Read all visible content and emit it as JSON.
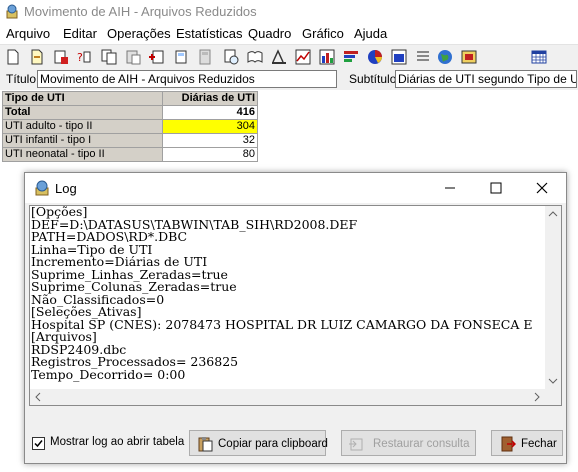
{
  "window": {
    "title": "Movimento de AIH - Arquivos Reduzidos"
  },
  "menu": [
    "Arquivo",
    "Editar",
    "Operações",
    "Estatísticas",
    "Quadro",
    "Gráfico",
    "Ajuda"
  ],
  "title_row": {
    "titulo_label": "Título",
    "titulo_value": "Movimento de AIH - Arquivos Reduzidos",
    "subtitulo_label": "Subtítulo",
    "subtitulo_value": "Diárias de UTI segundo Tipo de UTI"
  },
  "grid": {
    "headers": [
      "Tipo de UTI",
      "Diárias de UTI"
    ],
    "total": {
      "label": "Total",
      "value": "416"
    },
    "rows": [
      {
        "label": "UTI adulto - tipo II",
        "value": "304"
      },
      {
        "label": "UTI infantil - tipo I",
        "value": "32"
      },
      {
        "label": "UTI neonatal - tipo II",
        "value": "80"
      }
    ],
    "highlight_color": "#ffff00"
  },
  "log_window": {
    "title": "Log",
    "content": "[Opções]\nDEF=D:\\DATASUS\\TABWIN\\TAB_SIH\\RD2008.DEF\nPATH=DADOS\\RD*.DBC\nLinha=Tipo de UTI\nIncremento=Diárias de UTI\nSuprime_Linhas_Zeradas=true\nSuprime_Colunas_Zeradas=true\nNão_Classificados=0\n[Seleções_Ativas]\nHospital SP (CNES): 2078473 HOSPITAL DR LUIZ CAMARGO DA FONSECA E\n[Arquivos]\nRDSP2409.dbc\nRegistros_Processados= 236825\nTempo_Decorrido= 0:00",
    "checkbox_label": "Mostrar log ao abrir tabela",
    "checkbox_checked": true,
    "copy_button": "Copiar para clipboard",
    "restore_button": "Restaurar consulta",
    "close_button": "Fechar"
  }
}
